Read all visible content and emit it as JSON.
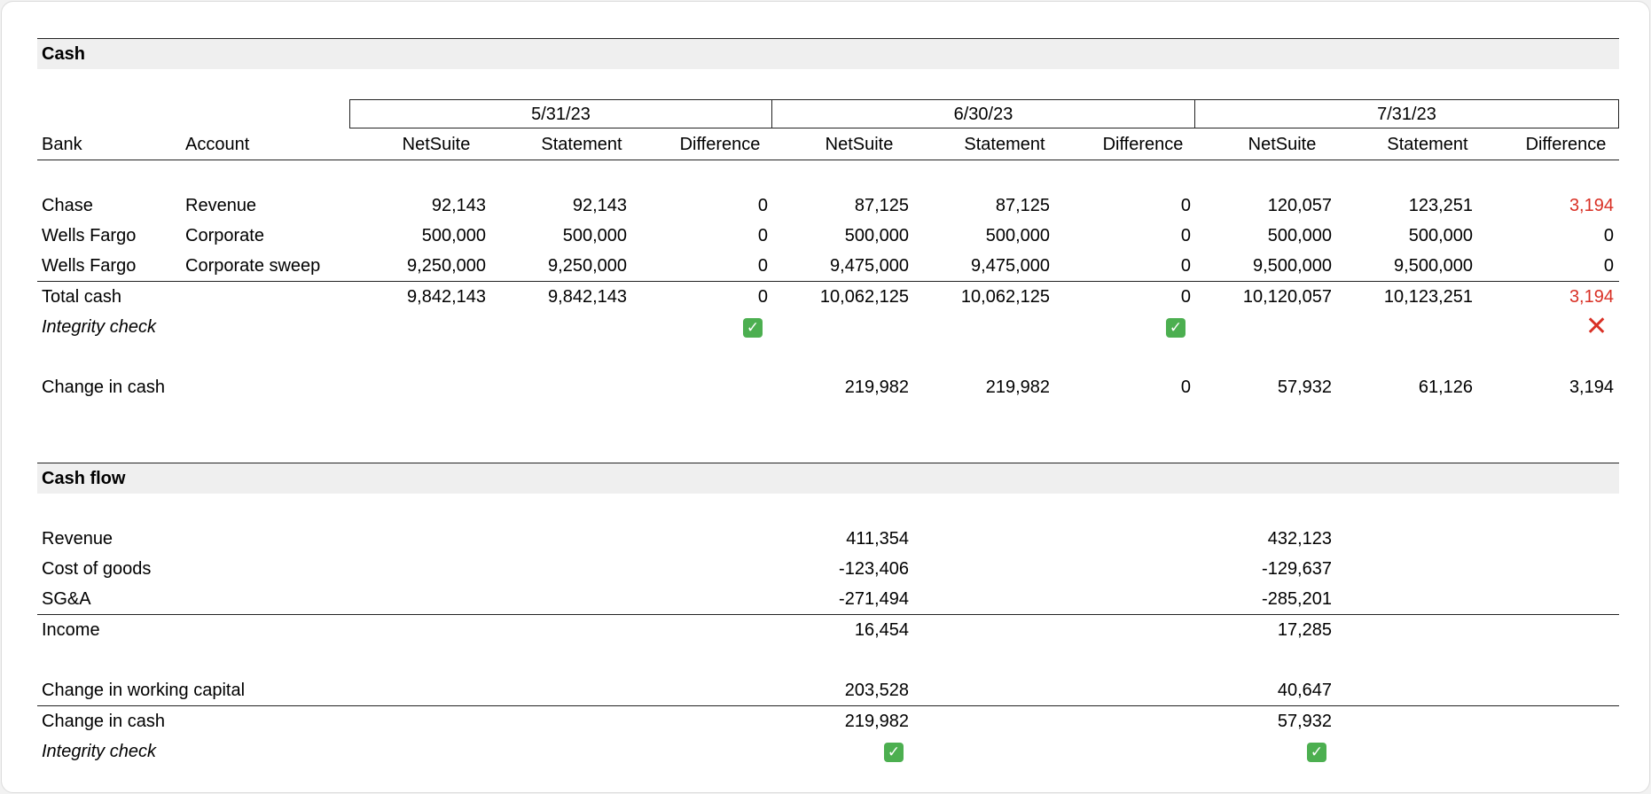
{
  "cash": {
    "title": "Cash",
    "dates": [
      "5/31/23",
      "6/30/23",
      "7/31/23"
    ],
    "col_headers": {
      "bank": "Bank",
      "account": "Account",
      "netsuite": "NetSuite",
      "statement": "Statement",
      "difference": "Difference"
    },
    "rows": [
      {
        "bank": "Chase",
        "account": "Revenue",
        "vals": [
          "92,143",
          "92,143",
          "0",
          "87,125",
          "87,125",
          "0",
          "120,057",
          "123,251",
          "3,194"
        ]
      },
      {
        "bank": "Wells Fargo",
        "account": "Corporate",
        "vals": [
          "500,000",
          "500,000",
          "0",
          "500,000",
          "500,000",
          "0",
          "500,000",
          "500,000",
          "0"
        ]
      },
      {
        "bank": "Wells Fargo",
        "account": "Corporate sweep",
        "vals": [
          "9,250,000",
          "9,250,000",
          "0",
          "9,475,000",
          "9,475,000",
          "0",
          "9,500,000",
          "9,500,000",
          "0"
        ]
      }
    ],
    "total": {
      "label": "Total cash",
      "vals": [
        "9,842,143",
        "9,842,143",
        "0",
        "10,062,125",
        "10,062,125",
        "0",
        "10,120,057",
        "10,123,251",
        "3,194"
      ]
    },
    "integrity": {
      "label": "Integrity check",
      "results": [
        "pass",
        "pass",
        "fail"
      ]
    },
    "change": {
      "label": "Change in cash",
      "vals": [
        "",
        "",
        "",
        "219,982",
        "219,982",
        "0",
        "57,932",
        "61,126",
        "3,194"
      ]
    },
    "colors": {
      "alert": "#d93025",
      "pass": "#4caf50"
    }
  },
  "cashflow": {
    "title": "Cash flow",
    "rows": [
      {
        "label": "Revenue",
        "v1": "411,354",
        "v2": "432,123"
      },
      {
        "label": "Cost of goods",
        "v1": "-123,406",
        "v2": "-129,637"
      },
      {
        "label": "SG&A",
        "v1": "-271,494",
        "v2": "-285,201"
      }
    ],
    "income": {
      "label": "Income",
      "v1": "16,454",
      "v2": "17,285"
    },
    "wc": {
      "label": "Change in working capital",
      "v1": "203,528",
      "v2": "40,647"
    },
    "change": {
      "label": "Change in cash",
      "v1": "219,982",
      "v2": "57,932"
    },
    "integrity": {
      "label": "Integrity check",
      "results": [
        "pass",
        "pass"
      ]
    }
  }
}
